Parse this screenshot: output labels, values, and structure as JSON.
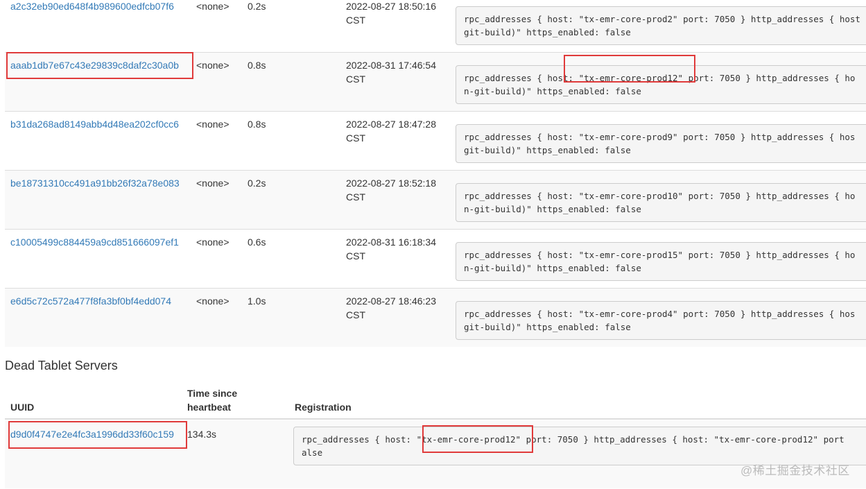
{
  "live_servers": [
    {
      "uuid": "a2c32eb90ed648f4b989600edfcb07f6",
      "location": "<none>",
      "heartbeat": "0.2s",
      "start_date": "2022-08-27 18:50:16",
      "start_tz": "CST",
      "reg_line1": "rpc_addresses { host: \"tx-emr-core-prod2\" port: 7050 } http_addresses { host",
      "reg_line2": "git-build)\" https_enabled: false"
    },
    {
      "uuid": "aaab1db7e67c43e29839c8daf2c30a0b",
      "location": "<none>",
      "heartbeat": "0.8s",
      "start_date": "2022-08-31 17:46:54",
      "start_tz": "CST",
      "reg_line1": "rpc_addresses { host: \"tx-emr-core-prod12\" port: 7050 } http_addresses { ho",
      "reg_line2": "n-git-build)\" https_enabled: false"
    },
    {
      "uuid": "b31da268ad8149abb4d48ea202cf0cc6",
      "location": "<none>",
      "heartbeat": "0.8s",
      "start_date": "2022-08-27 18:47:28",
      "start_tz": "CST",
      "reg_line1": "rpc_addresses { host: \"tx-emr-core-prod9\" port: 7050 } http_addresses { hos",
      "reg_line2": "git-build)\" https_enabled: false"
    },
    {
      "uuid": "be18731310cc491a91bb26f32a78e083",
      "location": "<none>",
      "heartbeat": "0.2s",
      "start_date": "2022-08-27 18:52:18",
      "start_tz": "CST",
      "reg_line1": "rpc_addresses { host: \"tx-emr-core-prod10\" port: 7050 } http_addresses { ho",
      "reg_line2": "n-git-build)\" https_enabled: false"
    },
    {
      "uuid": "c10005499c884459a9cd851666097ef1",
      "location": "<none>",
      "heartbeat": "0.6s",
      "start_date": "2022-08-31 16:18:34",
      "start_tz": "CST",
      "reg_line1": "rpc_addresses { host: \"tx-emr-core-prod15\" port: 7050 } http_addresses { ho",
      "reg_line2": "n-git-build)\" https_enabled: false"
    },
    {
      "uuid": "e6d5c72c572a477f8fa3bf0bf4edd074",
      "location": "<none>",
      "heartbeat": "1.0s",
      "start_date": "2022-08-27 18:46:23",
      "start_tz": "CST",
      "reg_line1": "rpc_addresses { host: \"tx-emr-core-prod4\" port: 7050 } http_addresses { hos",
      "reg_line2": "git-build)\" https_enabled: false"
    }
  ],
  "dead_section": {
    "title": "Dead Tablet Servers",
    "headers": {
      "uuid": "UUID",
      "time_since_heartbeat": "Time since heartbeat",
      "registration": "Registration"
    },
    "rows": [
      {
        "uuid": "d9d0f4747e2e4fc3a1996dd33f60c159",
        "heartbeat": "134.3s",
        "reg_line1": "rpc_addresses { host: \"tx-emr-core-prod12\" port: 7050 } http_addresses { host: \"tx-emr-core-prod12\" port",
        "reg_line2": "alse"
      }
    ]
  },
  "watermark": "@稀土掘金技术社区",
  "colors": {
    "link": "#337ab7",
    "highlight": "#e03a3a",
    "stripe": "#f9f9f9",
    "code_bg": "#f5f5f5"
  }
}
